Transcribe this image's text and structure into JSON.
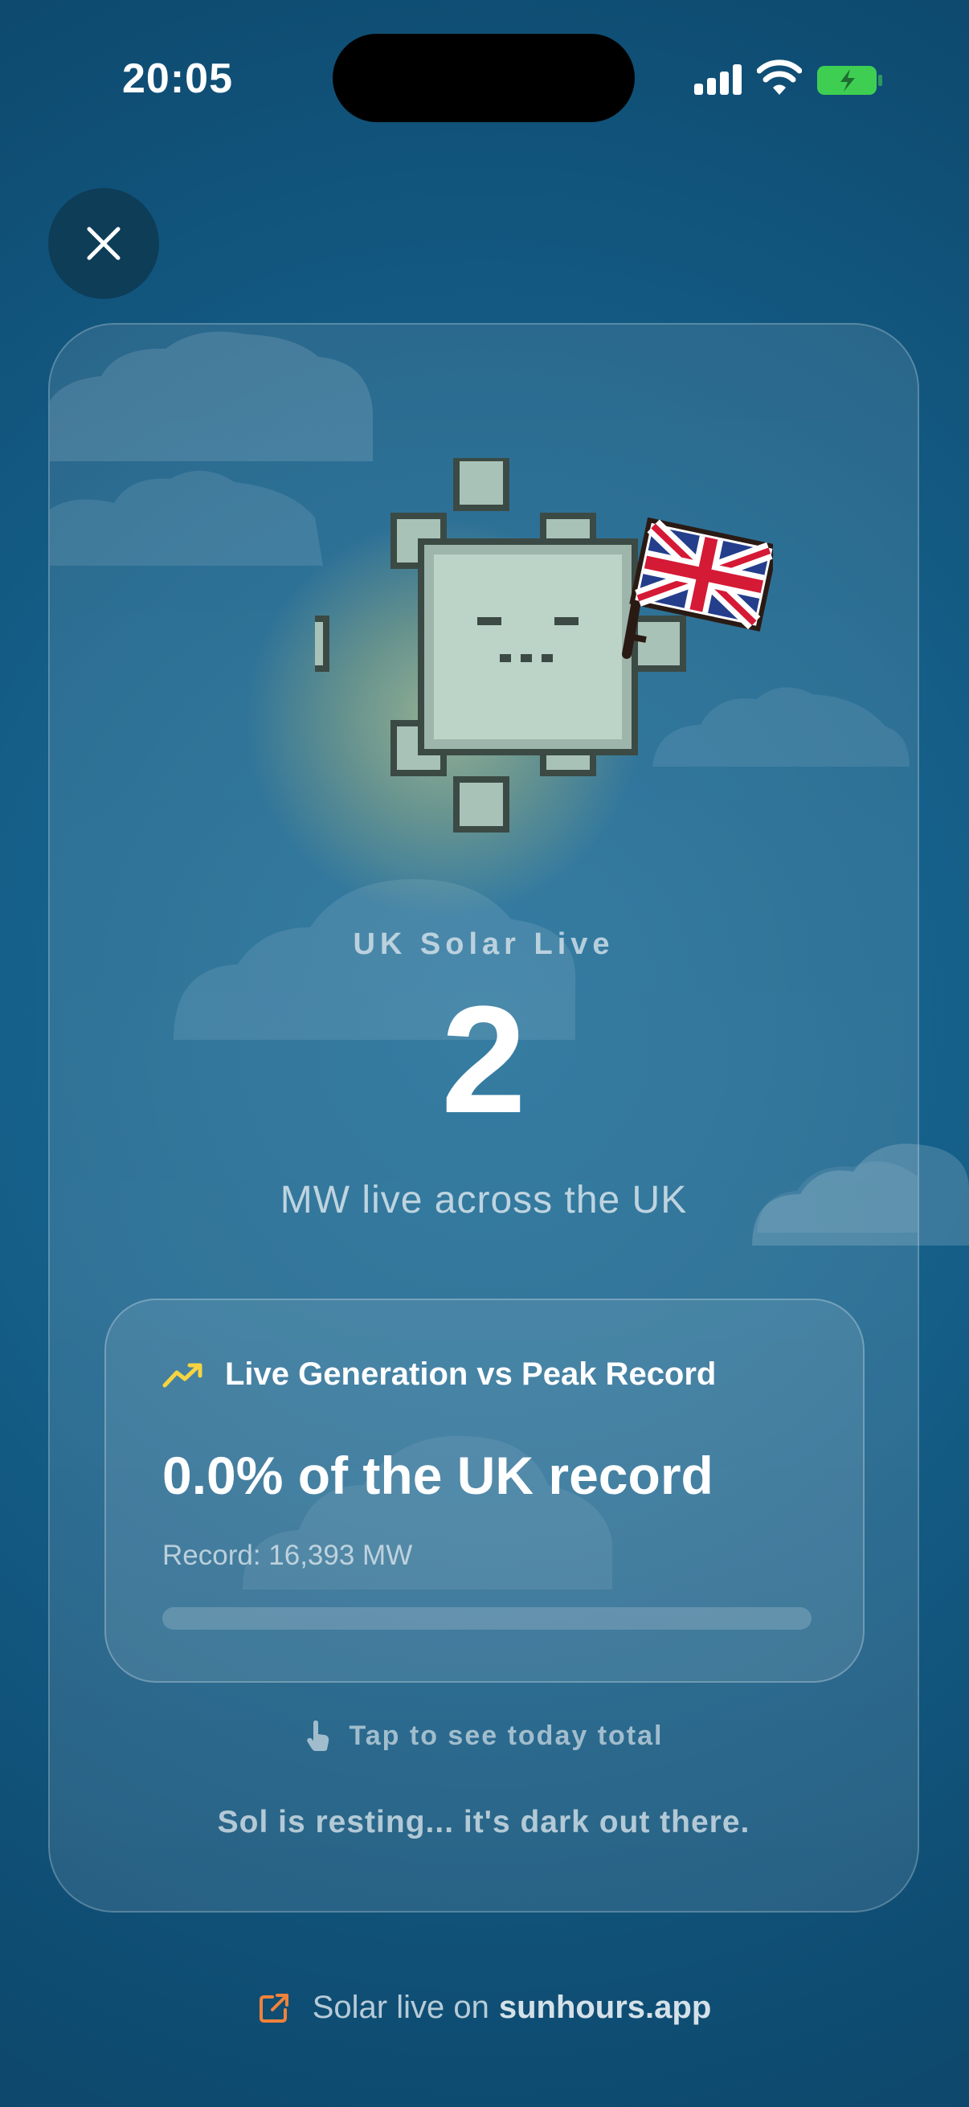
{
  "status_bar": {
    "time": "20:05"
  },
  "hero": {
    "label": "UK Solar Live",
    "value": "2",
    "unit_line": "MW live across the UK"
  },
  "stat_card": {
    "title": "Live Generation vs Peak Record",
    "value_text": "0.0% of the UK record",
    "record_text": "Record: 16,393 MW",
    "progress_fraction": 0.0
  },
  "tap_hint": "Tap to see today total",
  "status_message": "Sol is resting... it's dark out there.",
  "footer": {
    "prefix": "Solar live on",
    "domain": "sunhours.app"
  },
  "colors": {
    "accent_yellow": "#f5d442",
    "link_orange": "#f0823a",
    "battery_green": "#3ecf52"
  },
  "icons": [
    "close-icon",
    "trend-up-icon",
    "tap-finger-icon",
    "external-link-icon",
    "uk-flag-icon"
  ]
}
